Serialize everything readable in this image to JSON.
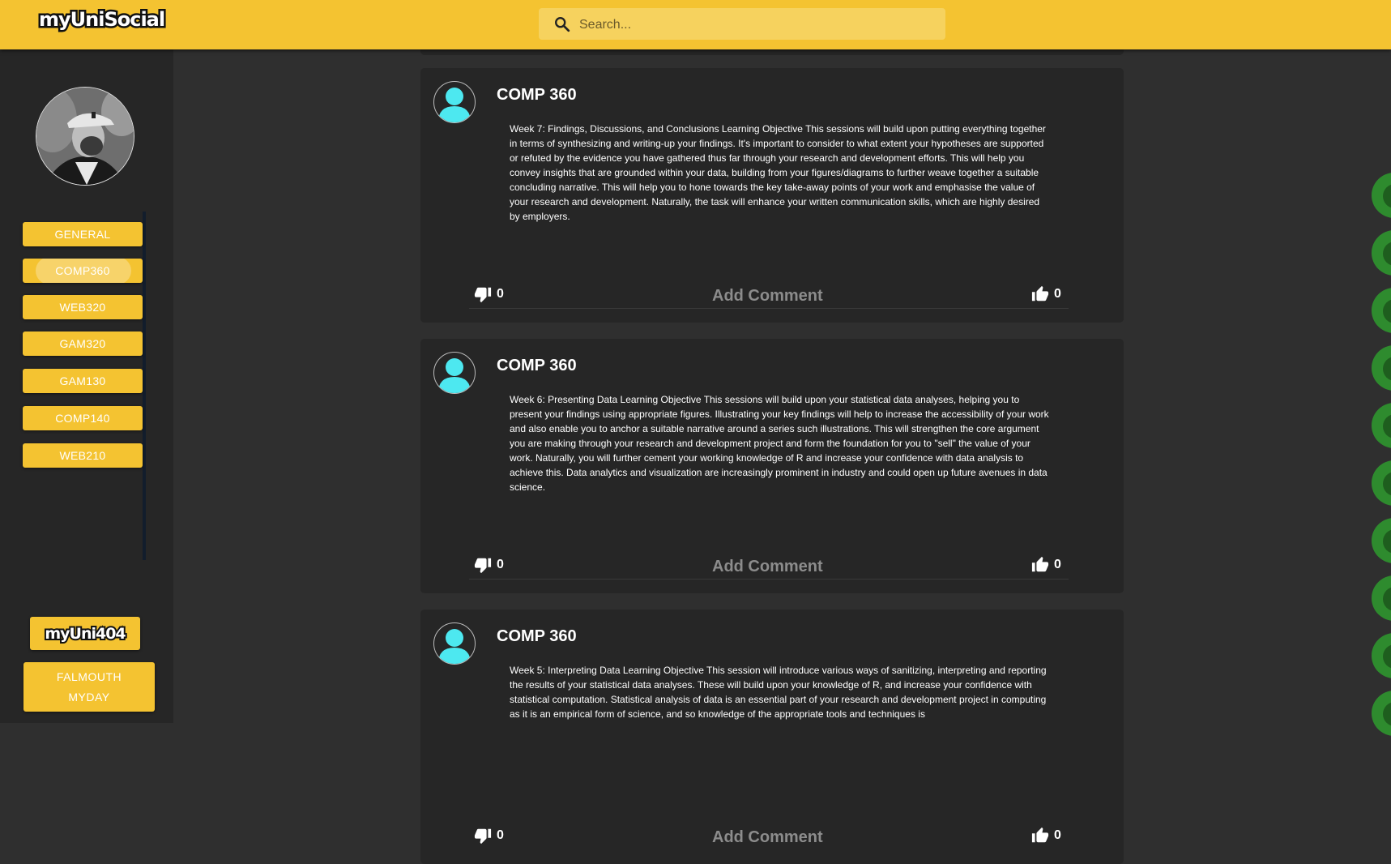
{
  "app": {
    "logo": "myUniSocial"
  },
  "search": {
    "placeholder": "Search..."
  },
  "sidebar": {
    "items": [
      {
        "label": "GENERAL"
      },
      {
        "label": "COMP360"
      },
      {
        "label": "WEB320"
      },
      {
        "label": "GAM320"
      },
      {
        "label": "GAM130"
      },
      {
        "label": "COMP140"
      },
      {
        "label": "WEB210"
      }
    ],
    "active": "COMP360",
    "uni404_label": "myUni404",
    "myday_line1": "FALMOUTH",
    "myday_line2": "MYDAY"
  },
  "posts": [
    {
      "title": "COMP 360",
      "body": "Week 7: Findings, Discussions, and Conclusions Learning Objective This sessions will build upon putting everything together in terms of synthesizing and writing-up your findings. It's important to consider to what extent your hypotheses are supported or refuted by the evidence you have gathered thus far through your research and development efforts. This will help you convey insights that are grounded within your data, building from your figures/diagrams to further weave together a suitable concluding narrative. This will help you to hone towards the key take-away points of your work and emphasise the value of your research and development. Naturally, the task will enhance your written communication skills, which are highly desired by employers.",
      "dislikes": "0",
      "likes": "0",
      "comment_label": "Add Comment"
    },
    {
      "title": "COMP 360",
      "body": "Week 6: Presenting Data Learning Objective This sessions will build upon your statistical data analyses, helping you to present your findings using appropriate figures. Illustrating your key findings will help to increase the accessibility of your work and also enable you to anchor a suitable narrative around a series such illustrations. This will strengthen the core argument you are making through your research and development project and form the foundation for you to \"sell\" the value of your work. Naturally, you will further cement your working knowledge of R and increase your confidence with data analysis to achieve this. Data analytics and visualization are increasingly prominent in industry and could open up future avenues in data science.",
      "dislikes": "0",
      "likes": "0",
      "comment_label": "Add Comment"
    },
    {
      "title": "COMP 360",
      "body": "Week 5: Interpreting Data Learning Objective This session will introduce various ways of sanitizing, interpreting and reporting the results of your statistical data analyses. These will build upon your knowledge of R, and increase your confidence with statistical computation. Statistical analysis of data is an essential part of your research and development project in computing as it is an empirical form of science, and so knowledge of the appropriate tools and techniques is",
      "dislikes": "0",
      "likes": "0",
      "comment_label": "Add Comment"
    }
  ],
  "colors": {
    "brand": "#f4c331",
    "background": "#2f2f2f",
    "panel": "#262626",
    "avatar_accent": "#4de8f0"
  },
  "icons": {
    "search": "search-icon",
    "like": "thumbs-up-icon",
    "dislike": "thumbs-down-icon",
    "avatar": "user-avatar-icon"
  }
}
